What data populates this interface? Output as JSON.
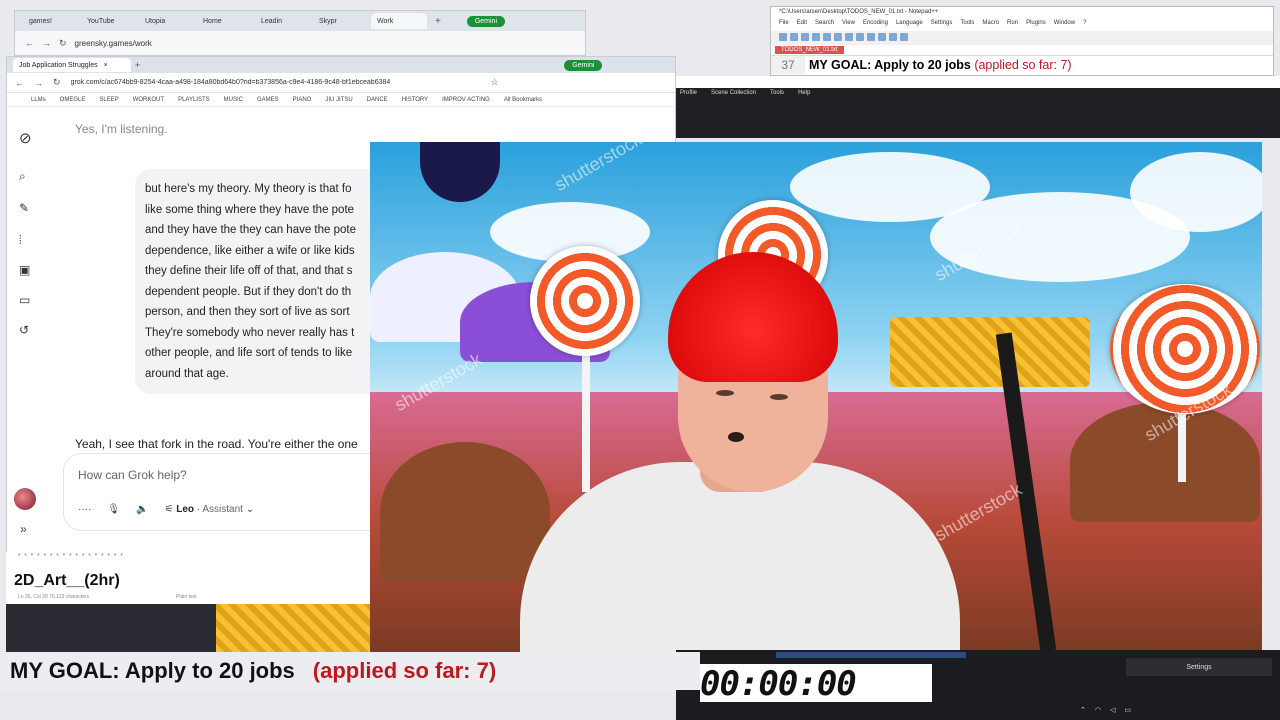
{
  "bg_browser": {
    "tabs": [
      "games!",
      "YouTube",
      "Utopia",
      "Home",
      "Leadin",
      "Skypr",
      "Work"
    ],
    "active_tab_index": 6,
    "gemini_label": "Gemini",
    "url": "greensky.games/work"
  },
  "main_browser": {
    "tab_label": "Job Application Struggles",
    "gemini_label": "Gemini",
    "url": "grok.com/c/ac674bb9-8254-4caa-a498-184a80bd64b0?rid=b373856a-c9e4-4186-9c48-bf1ebceab6384",
    "bookmarks": [
      "LLMs",
      "OMEGLE",
      "SLEEP",
      "WORKOUT",
      "PLAYLISTS",
      "MUSIC",
      "GAMES",
      "PIANO",
      "JIU JITSU",
      "DANCE",
      "HISTORY",
      "IMPROV ACTING",
      "All Bookmarks"
    ]
  },
  "grok": {
    "sidebar_icons": [
      "grok-logo-icon",
      "search-icon",
      "edit-icon",
      "voice-icon",
      "image-icon",
      "folder-icon",
      "history-icon"
    ],
    "listening": "Yes, I'm listening.",
    "user_message_lines": [
      "but here's my theory. My theory is that fo",
      "like some thing where they have the pote",
      "and they have the they can have the pote",
      "dependence, like either a wife or like kids",
      "they define their life off of that, and that s",
      "dependent people. But if they don't do th",
      "person, and then they sort of live as sort",
      "They're somebody who never really has t",
      "other people, and life sort of tends to like",
      "around that age."
    ],
    "reply": "Yeah, I see that fork in the road. You're either the one",
    "input_placeholder": "How can Grok help?",
    "voice_name": "Leo",
    "voice_role": "Assistant"
  },
  "notepad": {
    "title": "*C:\\Users\\arsen\\Desktop\\TODOS_NEW_01.txt - Notepad++",
    "menu": [
      "File",
      "Edit",
      "Search",
      "View",
      "Encoding",
      "Language",
      "Settings",
      "Tools",
      "Macro",
      "Run",
      "Plugins",
      "Window",
      "?"
    ],
    "tab": "TODOS_NEW_01.txt",
    "line_number": "37",
    "line_text": "MY GOAL:  Apply to 20 jobs",
    "line_text_red": "(applied so far: 7)"
  },
  "obs": {
    "menu": [
      "Profile",
      "Scene Collection",
      "Tools",
      "Help"
    ],
    "settings_label": "Settings"
  },
  "doc": {
    "title": "2D_Art__(2hr)",
    "meta": "Ln 26, Col 28    76,123 characters",
    "meta2": "Plain text"
  },
  "goal": {
    "main": "MY GOAL:  Apply to 20 jobs",
    "progress": "(applied so far: 7)"
  },
  "timer": "00:00:00",
  "watermarks": [
    "shutterstock",
    "shutterstock",
    "shutterstock",
    "shutterstock",
    "shutterstock"
  ]
}
